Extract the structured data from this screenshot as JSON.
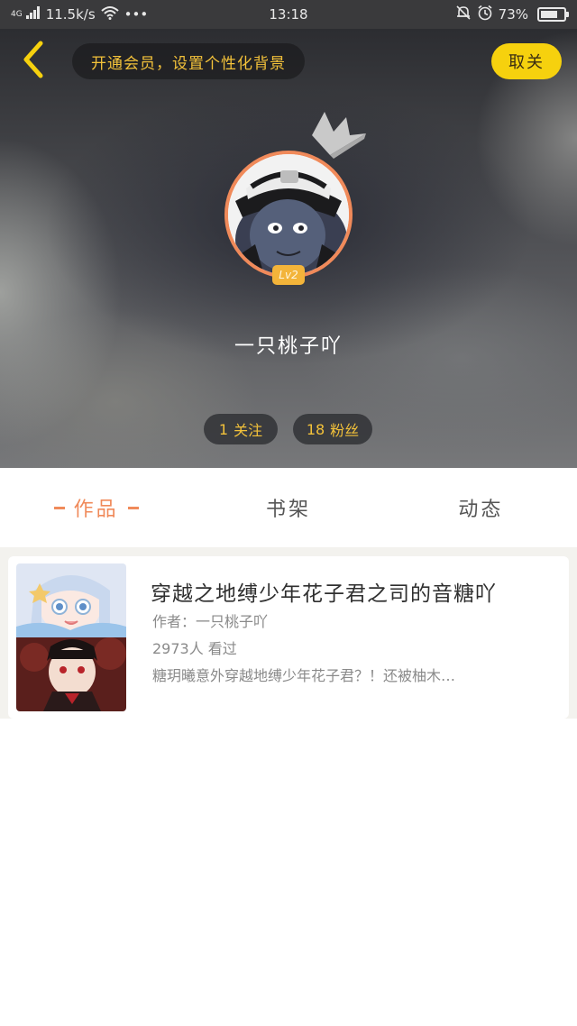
{
  "status_bar": {
    "network_type": "4G",
    "speed": "11.5k/s",
    "more": "•••",
    "time": "13:18",
    "battery_percent": "73%",
    "battery_level": 0.73
  },
  "header": {
    "vip_banner": "开通会员，设置个性化背景",
    "unfollow_label": "取关"
  },
  "profile": {
    "level": "Lv2",
    "username": "一只桃子吖",
    "following_count": "1",
    "following_label": "关注",
    "fans_count": "18",
    "fans_label": "粉丝"
  },
  "tabs": [
    {
      "label": "作品",
      "active": true
    },
    {
      "label": "书架",
      "active": false
    },
    {
      "label": "动态",
      "active": false
    }
  ],
  "works": [
    {
      "title": "穿越之地缚少年花子君之司的音糖吖",
      "author": "作者：一只桃子吖",
      "views": "2973人 看过",
      "description": "糖玥曦意外穿越地缚少年花子君？！还被柚木…"
    }
  ],
  "colors": {
    "accent_orange": "#f08a5a",
    "gold_text": "#f3c23a",
    "unfollow_yellow": "#f6d10e",
    "level_badge": "#f3b43a"
  }
}
